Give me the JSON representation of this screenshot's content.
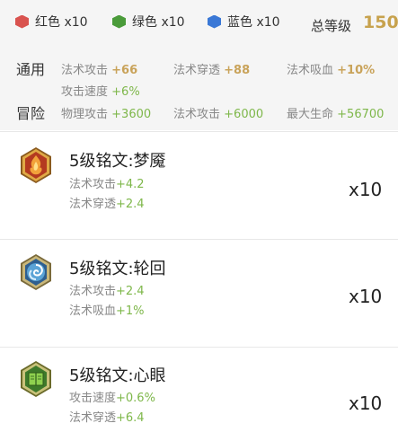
{
  "totals": {
    "red": {
      "label": "红色 x10",
      "color": "#d9534f"
    },
    "green": {
      "label": "绿色 x10",
      "color": "#4a9b3a"
    },
    "blue": {
      "label": "蓝色 x10",
      "color": "#3a78d6"
    },
    "level_label": "总等级",
    "level_value": "150"
  },
  "general": {
    "label": "通用",
    "items": [
      {
        "name": "法术攻击",
        "value": "+66"
      },
      {
        "name": "法术穿透",
        "value": "+88"
      },
      {
        "name": "法术吸血",
        "value": "+10%"
      },
      {
        "name": "攻击速度",
        "value": "+6%"
      }
    ]
  },
  "adventure": {
    "label": "冒险",
    "items": [
      {
        "name": "物理攻击",
        "value": "+3600"
      },
      {
        "name": "法术攻击",
        "value": "+6000"
      },
      {
        "name": "最大生命",
        "value": "+56700"
      }
    ]
  },
  "runes": [
    {
      "title": "5级铭文:梦魇",
      "icon": "red-flame-rune-icon",
      "stats": [
        {
          "name": "法术攻击",
          "value": "+4.2"
        },
        {
          "name": "法术穿透",
          "value": "+2.4"
        }
      ],
      "qty": "x10"
    },
    {
      "title": "5级铭文:轮回",
      "icon": "blue-swirl-rune-icon",
      "stats": [
        {
          "name": "法术攻击",
          "value": "+2.4"
        },
        {
          "name": "法术吸血",
          "value": "+1%"
        }
      ],
      "qty": "x10"
    },
    {
      "title": "5级铭文:心眼",
      "icon": "green-book-rune-icon",
      "stats": [
        {
          "name": "攻击速度",
          "value": "+0.6%"
        },
        {
          "name": "法术穿透",
          "value": "+6.4"
        }
      ],
      "qty": "x10"
    }
  ]
}
